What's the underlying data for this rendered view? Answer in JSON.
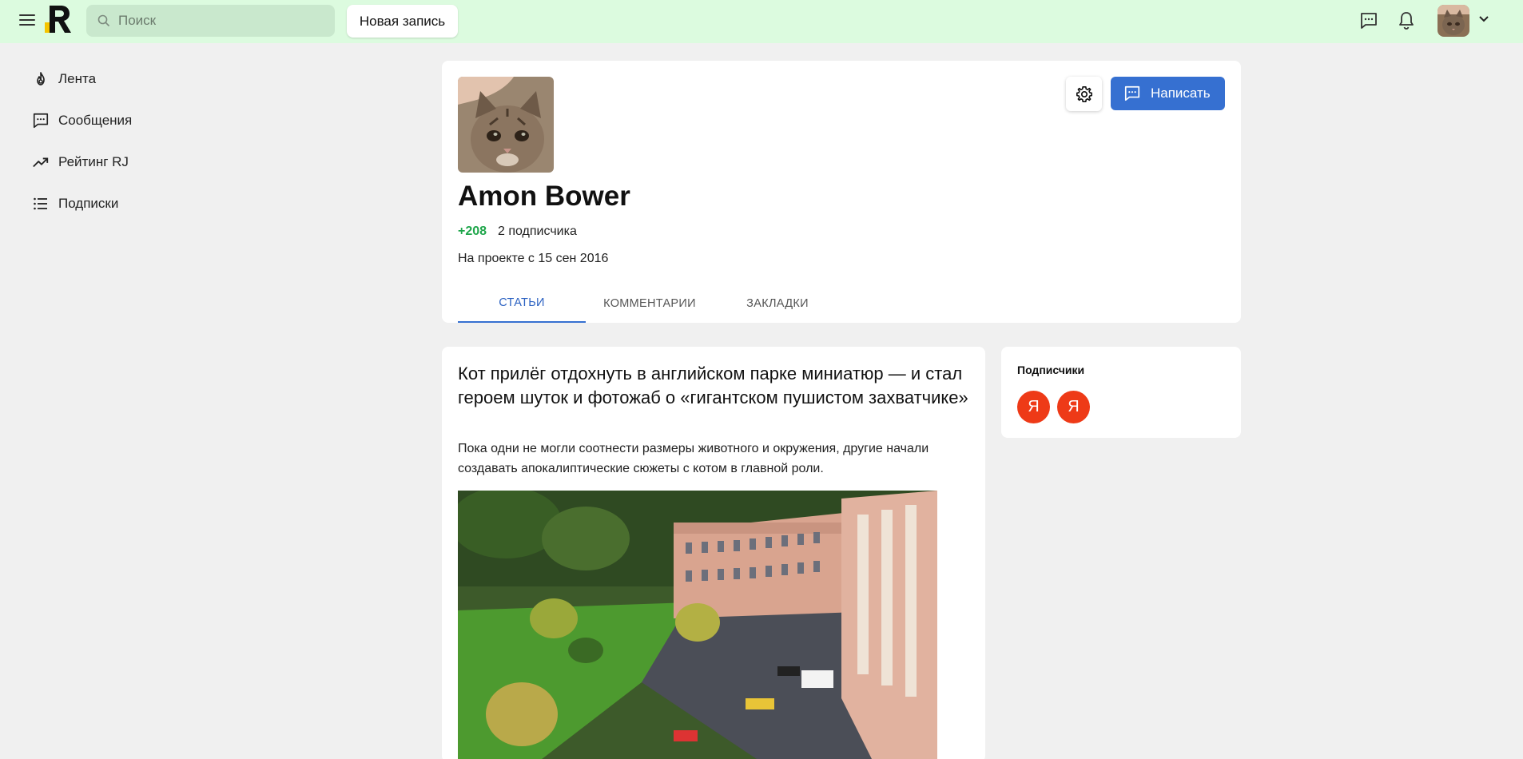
{
  "header": {
    "search_placeholder": "Поиск",
    "new_post_label": "Новая запись",
    "colors": {
      "background": "#dcfbdf",
      "search_bg": "#c9e8cd"
    }
  },
  "sidebar": {
    "items": [
      {
        "label": "Лента",
        "icon": "fire-icon"
      },
      {
        "label": "Сообщения",
        "icon": "message-icon"
      },
      {
        "label": "Рейтинг RJ",
        "icon": "trending-up-icon"
      },
      {
        "label": "Подписки",
        "icon": "list-icon"
      }
    ]
  },
  "profile": {
    "name": "Amon Bower",
    "rating": "+208",
    "subscribers": "2 подписчика",
    "since": "На проекте с 15 сен 2016",
    "write_label": "Написать",
    "tabs": [
      {
        "label": "СТАТЬИ",
        "active": true
      },
      {
        "label": "КОММЕНТАРИИ",
        "active": false
      },
      {
        "label": "ЗАКЛАДКИ",
        "active": false
      }
    ]
  },
  "article": {
    "title": "Кот прилёг отдохнуть в английском парке миниатюр — и стал героем шуток и фотожаб о «гигантском пушистом захватчике»",
    "lead": "Пока одни не могли соотнести размеры животного и окружения, другие начали создавать апокалиптические сюжеты с котом в главной роли."
  },
  "subscribers_widget": {
    "title": "Подписчики",
    "avatars": [
      "Я",
      "Я"
    ]
  },
  "colors": {
    "accent": "#3670d1",
    "rating_green": "#1fa64b",
    "subscriber_avatar": "#ee3a17"
  }
}
